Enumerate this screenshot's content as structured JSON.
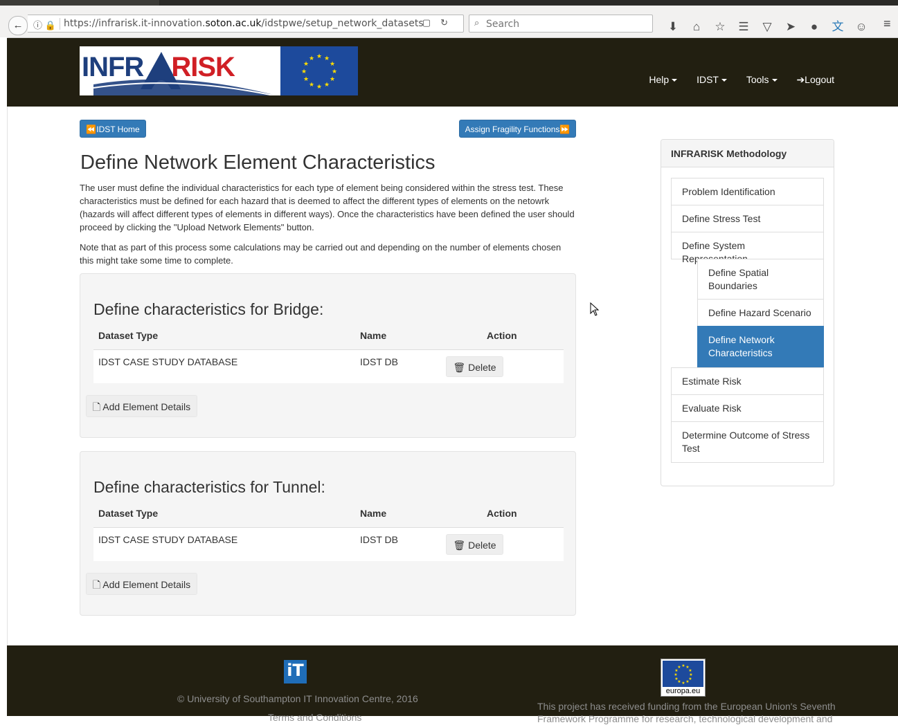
{
  "browser": {
    "url_prefix": "https://infrarisk.it-innovation.",
    "url_domain": "soton.ac.uk",
    "url_path": "/idstpwe/setup_network_datasets",
    "search_placeholder": "Search"
  },
  "navbar": {
    "logo_text_a": "INFR",
    "logo_text_b": "RISK",
    "items": [
      {
        "label": "Help"
      },
      {
        "label": "IDST"
      },
      {
        "label": "Tools"
      },
      {
        "label": "Logout"
      }
    ]
  },
  "buttons": {
    "home": "IDST Home",
    "assign": "Assign Fragility Functions"
  },
  "page": {
    "title": "Define Network Element Characteristics",
    "intro": "The user must define the individual characteristics for each type of element being considered within the stress test. These characteristics must be defined for each hazard that is deemed to affect the different types of elements on the netowrk (hazards will affect different types of elements in different ways). Once the characteristics have been defined the user should proceed by clicking the \"Upload Network Elements\" button.",
    "note": "Note that as part of this process some calculations may be carried out and depending on the number of elements chosen this might take some time to complete."
  },
  "table_headers": {
    "dataset_type": "Dataset Type",
    "name": "Name",
    "action": "Action"
  },
  "sections": [
    {
      "title": "Define characteristics for Bridge:",
      "rows": [
        {
          "dataset_type": "IDST CASE STUDY DATABASE",
          "name": "IDST DB",
          "action": "Delete"
        }
      ],
      "add_label": "Add Element Details"
    },
    {
      "title": "Define characteristics for Tunnel:",
      "rows": [
        {
          "dataset_type": "IDST CASE STUDY DATABASE",
          "name": "IDST DB",
          "action": "Delete"
        }
      ],
      "add_label": "Add Element Details"
    }
  ],
  "sidebar": {
    "title": "INFRARISK Methodology",
    "items": [
      {
        "label": "Problem Identification"
      },
      {
        "label": "Define Stress Test"
      },
      {
        "label": "Define System Representation"
      },
      {
        "label": "Define Spatial Boundaries"
      },
      {
        "label": "Define Hazard Scenario"
      },
      {
        "label": "Define Network Characteristics",
        "active": true
      },
      {
        "label": "Estimate Risk"
      },
      {
        "label": "Evaluate Risk"
      },
      {
        "label": "Determine Outcome of Stress Test"
      }
    ]
  },
  "footer": {
    "it_logo": "iT",
    "copyright": "© University of Southampton IT Innovation Centre, 2016",
    "terms": "Terms and Conditions",
    "eu_label": "europa.eu",
    "funding": "This project has received funding from the European Union's Seventh Framework Programme for research, technological development and"
  },
  "colors": {
    "navbar_bg": "#221f11",
    "primary": "#337ab7",
    "logo_blue": "#1e3f7d",
    "logo_red": "#d01f25"
  }
}
